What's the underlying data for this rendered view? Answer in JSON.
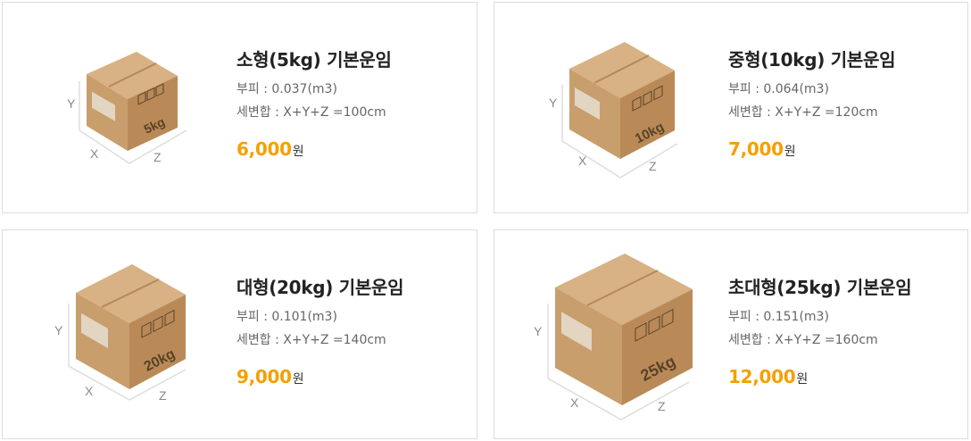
{
  "products": [
    {
      "title": "소형(5kg) 기본운임",
      "volume": "부피 : 0.037(m3)",
      "dimension_sum": "세변합 : X+Y+Z =100cm",
      "price": "6,000",
      "currency": "원",
      "box_label": "5kg",
      "axis_x": "X",
      "axis_y": "Y",
      "axis_z": "Z"
    },
    {
      "title": "중형(10kg) 기본운임",
      "volume": "부피 : 0.064(m3)",
      "dimension_sum": "세변합 : X+Y+Z =120cm",
      "price": "7,000",
      "currency": "원",
      "box_label": "10kg",
      "axis_x": "X",
      "axis_y": "Y",
      "axis_z": "Z"
    },
    {
      "title": "대형(20kg) 기본운임",
      "volume": "부피 : 0.101(m3)",
      "dimension_sum": "세변합 : X+Y+Z =140cm",
      "price": "9,000",
      "currency": "원",
      "box_label": "20kg",
      "axis_x": "X",
      "axis_y": "Y",
      "axis_z": "Z"
    },
    {
      "title": "초대형(25kg) 기본운임",
      "volume": "부피 : 0.151(m3)",
      "dimension_sum": "세변합 : X+Y+Z =160cm",
      "price": "12,000",
      "currency": "원",
      "box_label": "25kg",
      "axis_x": "X",
      "axis_y": "Y",
      "axis_z": "Z"
    }
  ],
  "colors": {
    "price": "#f5a000",
    "box_top": "#d8b184",
    "box_left": "#c99e6d",
    "box_right": "#b98a57",
    "card_border": "#dcdcdc"
  }
}
